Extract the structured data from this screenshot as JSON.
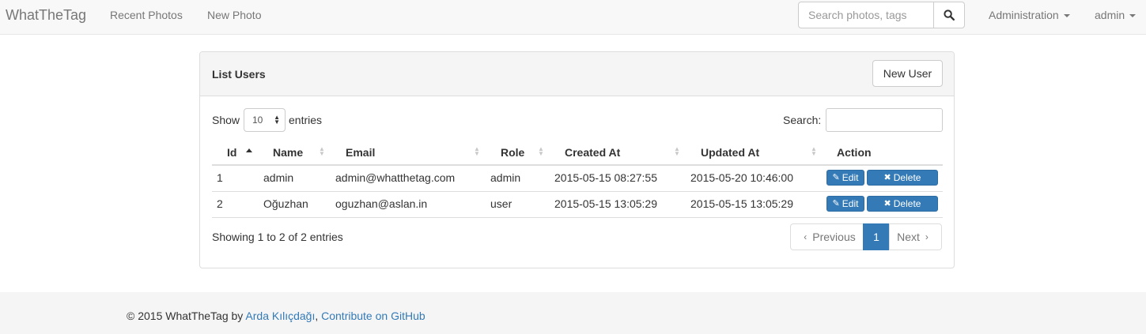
{
  "navbar": {
    "brand": "WhatTheTag",
    "links": [
      "Recent Photos",
      "New Photo"
    ],
    "search_placeholder": "Search photos, tags",
    "admin_menu": "Administration",
    "user_menu": "admin"
  },
  "panel": {
    "title": "List Users",
    "new_button": "New User",
    "length_label_pre": "Show",
    "length_value": "10",
    "length_label_post": "entries",
    "filter_label": "Search:",
    "columns": [
      "Id",
      "Name",
      "Email",
      "Role",
      "Created At",
      "Updated At",
      "Action"
    ],
    "rows": [
      {
        "id": "1",
        "name": "admin",
        "email": "admin@whatthetag.com",
        "role": "admin",
        "created": "2015-05-15 08:27:55",
        "updated": "2015-05-20 10:46:00"
      },
      {
        "id": "2",
        "name": "Oğuzhan",
        "email": "oguzhan@aslan.in",
        "role": "user",
        "created": "2015-05-15 13:05:29",
        "updated": "2015-05-15 13:05:29"
      }
    ],
    "edit_label": "Edit",
    "delete_label": "Delete",
    "info": "Showing 1 to 2 of 2 entries",
    "pagination": {
      "previous": "Previous",
      "current": "1",
      "next": "Next"
    }
  },
  "footer": {
    "prefix": "© 2015 WhatTheTag by ",
    "author": "Arda Kılıçdağı",
    "separator": ", ",
    "github": "Contribute on GitHub"
  },
  "colors": {
    "primary": "#337ab7",
    "navbar_bg": "#f8f8f8",
    "panel_heading_bg": "#f5f5f5",
    "footer_bg": "#f5f5f5"
  },
  "icons": [
    "search-icon",
    "caret-down-icon",
    "sort-icon",
    "sort-asc-icon",
    "edit-icon",
    "delete-icon",
    "chevron-left-icon",
    "chevron-right-icon"
  ]
}
